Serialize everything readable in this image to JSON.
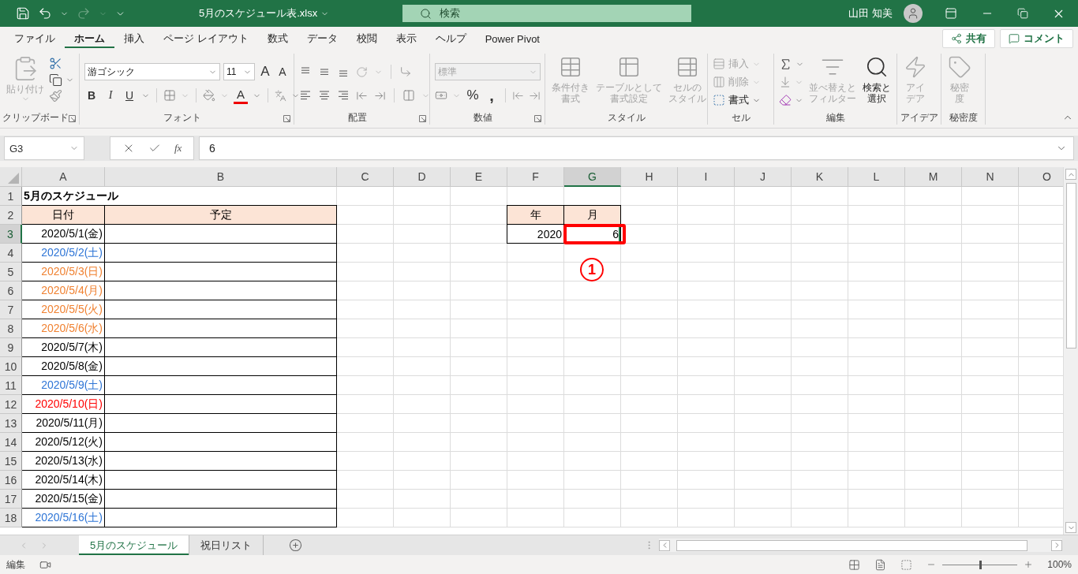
{
  "title_bar": {
    "file_name": "5月のスケジュール表.xlsx",
    "search_placeholder": "検索",
    "user": "山田 知美"
  },
  "ribbon_tabs": [
    {
      "label": "ファイル",
      "selected": false
    },
    {
      "label": "ホーム",
      "selected": true
    },
    {
      "label": "挿入",
      "selected": false
    },
    {
      "label": "ページ レイアウト",
      "selected": false
    },
    {
      "label": "数式",
      "selected": false
    },
    {
      "label": "データ",
      "selected": false
    },
    {
      "label": "校閲",
      "selected": false
    },
    {
      "label": "表示",
      "selected": false
    },
    {
      "label": "ヘルプ",
      "selected": false
    },
    {
      "label": "Power Pivot",
      "selected": false
    }
  ],
  "share_button": "共有",
  "comment_button": "コメント",
  "ribbon_groups": [
    {
      "kind": "clipboard",
      "label": "クリップボード",
      "launcher": true,
      "paste": {
        "label": "貼り付け",
        "disabled": true
      }
    },
    {
      "kind": "font",
      "label": "フォント",
      "launcher": true,
      "font_name": "游ゴシック",
      "font_size": "11",
      "grow": "A",
      "shrink": "A",
      "bold": "B",
      "italic": "I",
      "underline": "U",
      "font_color": "A"
    },
    {
      "kind": "alignment",
      "label": "配置",
      "launcher": true
    },
    {
      "kind": "number",
      "label": "数値",
      "launcher": true,
      "format": {
        "value": "標準",
        "disabled": true
      },
      "percent": "%",
      "comma": ","
    },
    {
      "kind": "styles",
      "label": "スタイル",
      "launcher": false,
      "buttons": [
        {
          "lines": [
            "条件付き",
            "書式"
          ],
          "disabled": true
        },
        {
          "lines": [
            "テーブルとして",
            "書式設定"
          ],
          "disabled": true
        },
        {
          "lines": [
            "セルの",
            "スタイル"
          ],
          "disabled": true
        }
      ]
    },
    {
      "kind": "cells",
      "label": "セル",
      "launcher": false,
      "buttons": [
        {
          "lines": [
            "挿入"
          ],
          "disabled": true
        },
        {
          "lines": [
            "削除"
          ],
          "disabled": true
        },
        {
          "lines": [
            "書式"
          ],
          "disabled": false
        }
      ]
    },
    {
      "kind": "editing",
      "label": "編集",
      "launcher": false,
      "buttons": [
        {
          "lines": [
            "並べ替えと",
            "フィルター"
          ],
          "disabled": true
        },
        {
          "lines": [
            "検索と",
            "選択"
          ],
          "disabled": false
        }
      ]
    },
    {
      "kind": "ideas",
      "label": "アイデア",
      "launcher": false,
      "buttons": [
        {
          "lines": [
            "アイ",
            "デア"
          ],
          "disabled": true
        }
      ]
    },
    {
      "kind": "sensitivity",
      "label": "秘密度",
      "launcher": false,
      "buttons": [
        {
          "lines": [
            "秘密",
            "度"
          ],
          "disabled": true
        }
      ]
    }
  ],
  "formula_bar": {
    "name_box": "G3",
    "function_label": "fx",
    "formula": "6"
  },
  "sheet": {
    "columns": [
      {
        "label": "A",
        "selected": false
      },
      {
        "label": "B",
        "selected": false
      },
      {
        "label": "C",
        "selected": false
      },
      {
        "label": "D",
        "selected": false
      },
      {
        "label": "E",
        "selected": false
      },
      {
        "label": "F",
        "selected": false
      },
      {
        "label": "G",
        "selected": true
      },
      {
        "label": "H",
        "selected": false
      },
      {
        "label": "I",
        "selected": false
      },
      {
        "label": "J",
        "selected": false
      },
      {
        "label": "K",
        "selected": false
      },
      {
        "label": "L",
        "selected": false
      },
      {
        "label": "M",
        "selected": false
      },
      {
        "label": "N",
        "selected": false
      },
      {
        "label": "O",
        "selected": false
      }
    ],
    "rows": [
      {
        "label": "1",
        "selected": false
      },
      {
        "label": "2",
        "selected": false
      },
      {
        "label": "3",
        "selected": true
      },
      {
        "label": "4",
        "selected": false
      },
      {
        "label": "5",
        "selected": false
      },
      {
        "label": "6",
        "selected": false
      },
      {
        "label": "7",
        "selected": false
      },
      {
        "label": "8",
        "selected": false
      },
      {
        "label": "9",
        "selected": false
      },
      {
        "label": "10",
        "selected": false
      },
      {
        "label": "11",
        "selected": false
      },
      {
        "label": "12",
        "selected": false
      },
      {
        "label": "13",
        "selected": false
      },
      {
        "label": "14",
        "selected": false
      },
      {
        "label": "15",
        "selected": false
      },
      {
        "label": "16",
        "selected": false
      },
      {
        "label": "17",
        "selected": false
      },
      {
        "label": "18",
        "selected": false
      }
    ]
  },
  "schedule": {
    "title": "5月のスケジュール",
    "headers": [
      "日付",
      "予定"
    ],
    "dates": [
      {
        "text": "2020/5/1(金)",
        "color": "#000000"
      },
      {
        "text": "2020/5/2(土)",
        "color": "#2e75d6"
      },
      {
        "text": "2020/5/3(日)",
        "color": "#f08232"
      },
      {
        "text": "2020/5/4(月)",
        "color": "#f08232"
      },
      {
        "text": "2020/5/5(火)",
        "color": "#f08232"
      },
      {
        "text": "2020/5/6(水)",
        "color": "#f08232"
      },
      {
        "text": "2020/5/7(木)",
        "color": "#000000"
      },
      {
        "text": "2020/5/8(金)",
        "color": "#000000"
      },
      {
        "text": "2020/5/9(土)",
        "color": "#2e75d6"
      },
      {
        "text": "2020/5/10(日)",
        "color": "#ff0000"
      },
      {
        "text": "2020/5/11(月)",
        "color": "#000000"
      },
      {
        "text": "2020/5/12(火)",
        "color": "#000000"
      },
      {
        "text": "2020/5/13(水)",
        "color": "#000000"
      },
      {
        "text": "2020/5/14(木)",
        "color": "#000000"
      },
      {
        "text": "2020/5/15(金)",
        "color": "#000000"
      },
      {
        "text": "2020/5/16(土)",
        "color": "#2e75d6"
      }
    ]
  },
  "year_month": {
    "headers": [
      "年",
      "月"
    ],
    "values": [
      {
        "text": "2020",
        "selected": false
      },
      {
        "text": "6",
        "selected": true
      }
    ]
  },
  "annotation": {
    "number": "1"
  },
  "sheet_tabs": [
    {
      "label": "5月のスケジュール",
      "selected": true
    },
    {
      "label": "祝日リスト",
      "selected": false
    }
  ],
  "status_bar": {
    "mode": "編集",
    "zoom": {
      "level": 0.5,
      "reading": "100%"
    }
  }
}
